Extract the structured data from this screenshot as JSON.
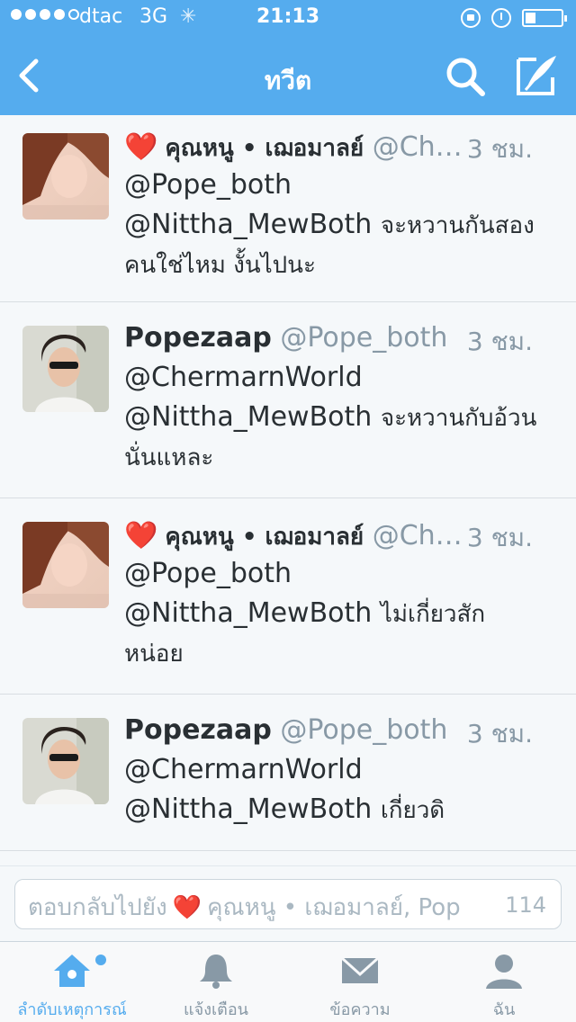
{
  "status_bar": {
    "carrier": "dtac",
    "network": "3G",
    "time": "21:13",
    "signal_bars_filled": 4,
    "signal_bars_total": 5,
    "battery_level": 0.3
  },
  "nav": {
    "title": "ทวีต",
    "back_icon": "chevron-left-icon",
    "search_icon": "search-icon",
    "compose_icon": "compose-icon"
  },
  "tweets": [
    {
      "heart": "❤️",
      "name": "คุณหนู • เฌอมาลย์",
      "handle": "@Ch…",
      "time": "3 ชม.",
      "lines": [
        "@Pope_both",
        "@Nittha_MewBoth",
        "จะหวานกันสอง",
        "คนใช่ไหม งั้นไปนะ"
      ]
    },
    {
      "name": "Popezaap",
      "handle": "@Pope_both",
      "time": "3 ชม.",
      "lines": [
        "@ChermarnWorld",
        "@Nittha_MewBoth",
        "จะหวานกับอ้วน",
        "นั่นแหละ"
      ]
    },
    {
      "heart": "❤️",
      "name": "คุณหนู • เฌอมาลย์",
      "handle": "@Ch…",
      "time": "3 ชม.",
      "lines": [
        "@Pope_both",
        "@Nittha_MewBoth",
        "ไม่เกี่ยวสัก",
        "หน่อย"
      ]
    },
    {
      "name": "Popezaap",
      "handle": "@Pope_both",
      "time": "3 ชม.",
      "lines": [
        "@ChermarnWorld",
        "@Nittha_MewBoth",
        "เกี่ยวดิ"
      ]
    }
  ],
  "reply": {
    "prefix": "ตอบกลับไปยัง",
    "heart": "❤️",
    "recipients": "คุณหนู • เฌอมาลย์, Pop",
    "char_count": "114"
  },
  "tabs": [
    {
      "label": "ลำดับเหตุการณ์",
      "icon": "home-icon",
      "active": true
    },
    {
      "label": "แจ้งเตือน",
      "icon": "bell-icon",
      "active": false
    },
    {
      "label": "ข้อความ",
      "icon": "envelope-icon",
      "active": false
    },
    {
      "label": "ฉัน",
      "icon": "person-icon",
      "active": false
    }
  ],
  "colors": {
    "brand": "#55acee",
    "heart": "#dd1122",
    "muted": "#8899a6"
  }
}
